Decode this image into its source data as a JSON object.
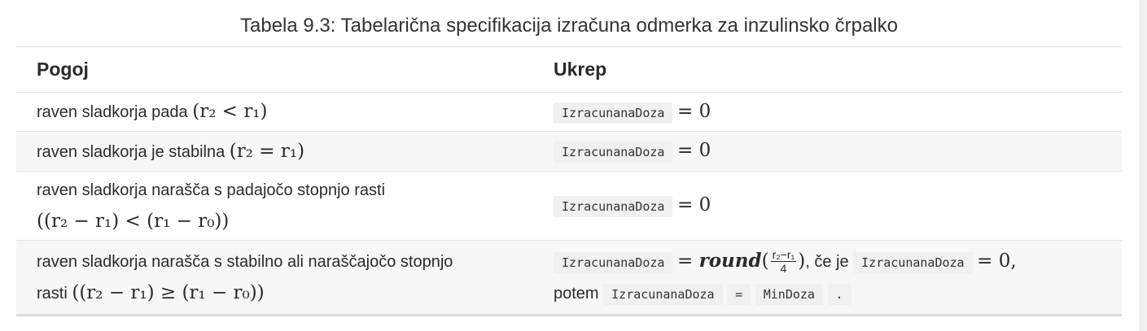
{
  "caption": "Tabela 9.3: Tabelarična specifikacija izračuna odmerka za inzulinsko črpalko",
  "headers": {
    "condition": "Pogoj",
    "action": "Ukrep"
  },
  "rows": [
    {
      "condition_text": "raven sladkorja pada ",
      "condition_math": "(r₂ < r₁)",
      "action_code": "IzracunanaDoza",
      "action_math": "= 0"
    },
    {
      "condition_text": "raven sladkorja je stabilna ",
      "condition_math": "(r₂ = r₁)",
      "action_code": "IzracunanaDoza",
      "action_math": "= 0"
    },
    {
      "condition_text": "raven sladkorja narašča s padajočo stopnjo rasti",
      "condition_math": "((r₂ − r₁) < (r₁ − r₀))",
      "action_code": "IzracunanaDoza",
      "action_math": "= 0"
    },
    {
      "condition_text": "raven sladkorja narašča s stabilno ali naraščajočo stopnjo",
      "condition_text2": "rasti ",
      "condition_math": "((r₂ − r₁) ≥ (r₁ − r₀))",
      "action_code": "IzracunanaDoza",
      "action_math_eq": "= ",
      "action_round": "round",
      "frac_num": "r₂−r₁",
      "frac_den": "4",
      "action_if": ", če je",
      "action_code2": "IzracunanaDoza",
      "action_math2": "= 0,",
      "action_then": "potem",
      "action_code3": "IzracunanaDoza",
      "action_assign": "=",
      "action_code4": "MinDoza",
      "action_end": "."
    }
  ]
}
